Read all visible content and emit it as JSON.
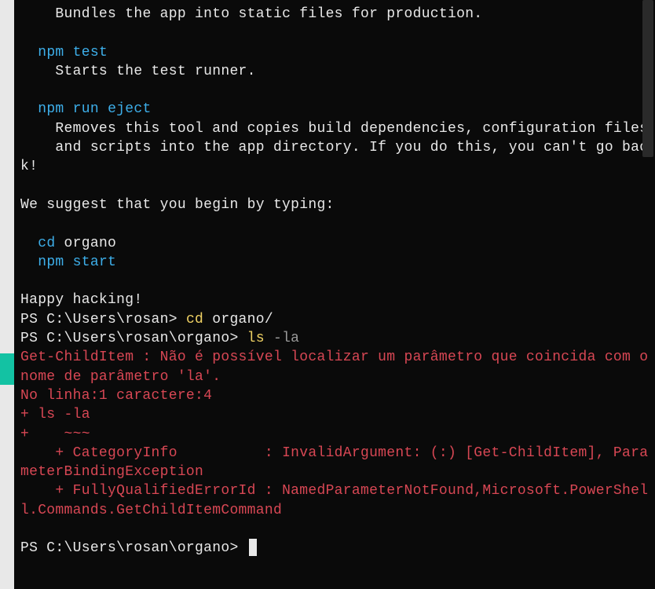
{
  "instructions": {
    "bundles_desc": "    Bundles the app into static files for production.",
    "npm": "  npm ",
    "test": "test",
    "test_desc": "    Starts the test runner.",
    "run": "run ",
    "eject": "eject",
    "eject_desc1": "    Removes this tool and copies build dependencies, configuration files",
    "eject_desc2": "    and scripts into the app directory. If you do this, you can't go back!",
    "suggest": "We suggest that you begin by typing:",
    "cd": "  cd ",
    "organo": "organo",
    "start": "start",
    "happy": "Happy hacking!"
  },
  "prompts": {
    "ps1": "PS C:\\Users\\rosan> ",
    "ps2": "PS C:\\Users\\rosan\\organo> ",
    "cd_cmd": "cd ",
    "cd_arg": "organo/",
    "ls_cmd": "ls ",
    "ls_arg": "-la"
  },
  "error": {
    "line1": "Get-ChildItem : Não é possível localizar um parâmetro que coincida com o nome de parâmetro 'la'.",
    "line2": "No linha:1 caractere:4",
    "line3": "+ ls -la",
    "line4": "+    ~~~",
    "line5": "    + CategoryInfo          : InvalidArgument: (:) [Get-ChildItem], ParameterBindingException",
    "line6": "    + FullyQualifiedErrorId : NamedParameterNotFound,Microsoft.PowerShell.Commands.GetChildItemCommand"
  }
}
